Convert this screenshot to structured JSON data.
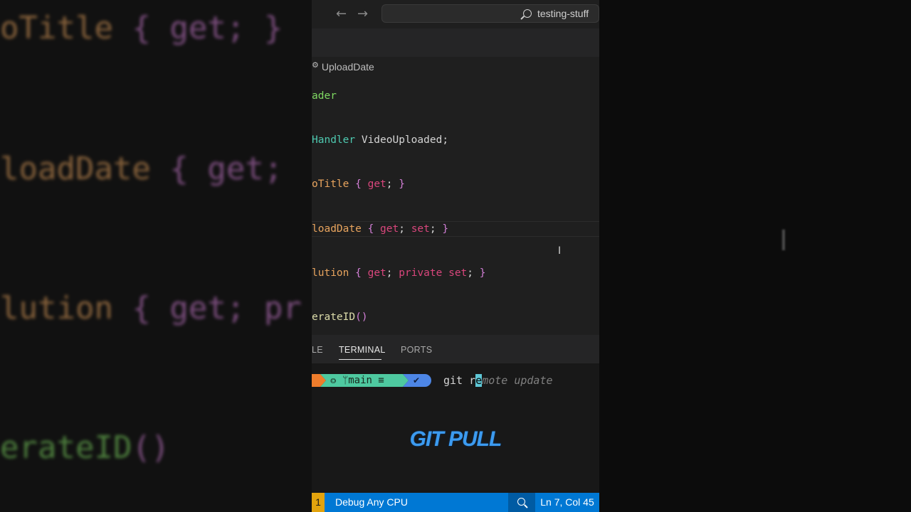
{
  "background": {
    "left_lines": [
      {
        "name": "VideoTitle",
        "prefix": "oTitle",
        "tail": "{ get; }"
      },
      {
        "name": "UploadDate",
        "prefix": "loadDate",
        "tail": "{ get;"
      },
      {
        "name": "Resolution",
        "prefix": "lution",
        "tail": "{ get; pr"
      },
      {
        "name": "GenerateID",
        "prefix": "erateID",
        "tail": "()"
      }
    ]
  },
  "titlebar": {
    "back_icon": "arrow-left-icon",
    "forward_icon": "arrow-right-icon",
    "search_label": "testing-stuff"
  },
  "editor": {
    "breadcrumb_label": "UploadDate",
    "lines": {
      "l1": "ader",
      "l2_type": "Handler",
      "l2_rest": " VideoUploaded;",
      "l3_name": "oTitle",
      "l3_open": " {",
      "l3_get": " get",
      "l3_semi": ";",
      "l3_close": " }",
      "l4_name": "loadDate",
      "l4_open": " {",
      "l4_get": " get",
      "l4_semi1": ";",
      "l4_set": " set",
      "l4_semi2": ";",
      "l4_close": " }",
      "l5_name": "lution",
      "l5_open": " {",
      "l5_get": " get",
      "l5_semi1": ";",
      "l5_private": " private",
      "l5_set": " set",
      "l5_semi2": ";",
      "l5_close": " }",
      "l6_name": "erateID",
      "l6_parens": "()"
    }
  },
  "panel": {
    "tabs": [
      "LE",
      "TERMINAL",
      "PORTS"
    ],
    "active_tab": "TERMINAL"
  },
  "terminal": {
    "branch_segment": "⭗ ᛘmain ≡",
    "check_glyph": "✔",
    "command_typed_1": "git r",
    "command_cursor_char": "e",
    "command_suggestion": "mote update",
    "overlay_title": "GIT PULL"
  },
  "statusbar": {
    "problem_count": "1",
    "configuration": "Debug Any CPU",
    "zoom_icon": "zoom-icon",
    "position": "Ln 7, Col 45"
  },
  "colors": {
    "accent": "#0078d4",
    "property": "#e8a45e",
    "keyword": "#d9467c",
    "brace": "#d27fd6",
    "type": "#4ec9b0",
    "git_segment": "#4ec9a0",
    "check_segment": "#4d86e6",
    "overlay_text": "#3c9bf0"
  }
}
